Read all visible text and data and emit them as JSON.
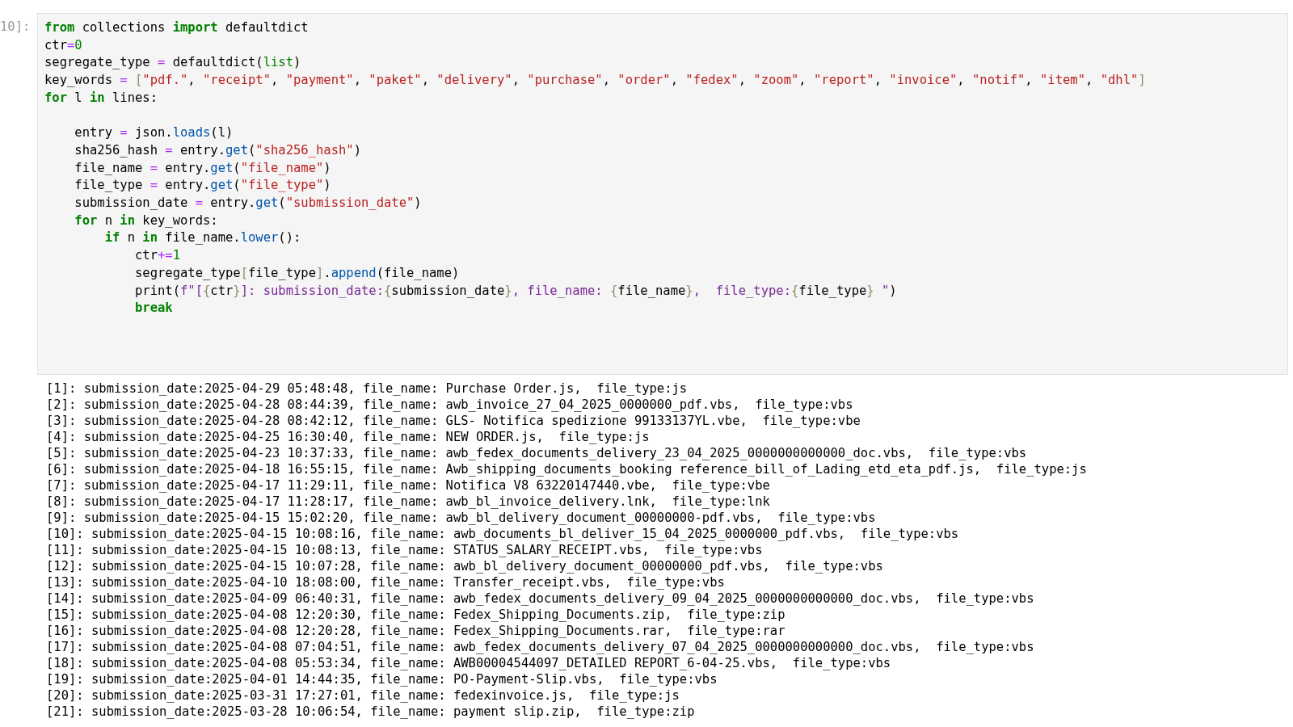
{
  "cell": {
    "prompt": "10]:",
    "code_lines": [
      {
        "space_before": false,
        "tokens": [
          {
            "kw": "from"
          },
          {
            "name": " collections "
          },
          {
            "kw": "import"
          },
          {
            "name": " defaultdict"
          }
        ]
      },
      {
        "space_before": false,
        "tokens": [
          {
            "name": "ctr"
          },
          {
            "op": "="
          },
          {
            "num": "0"
          }
        ]
      },
      {
        "space_before": false,
        "tokens": [
          {
            "name": "segregate_type "
          },
          {
            "op": "="
          },
          {
            "name": " defaultdict("
          },
          {
            "builtin": "list"
          },
          {
            "name": ")"
          }
        ]
      },
      {
        "space_before": false,
        "tokens": [
          {
            "name": "key_words "
          },
          {
            "op": "="
          },
          {
            "punct": " ["
          },
          {
            "str": "\"pdf.\""
          },
          {
            "name": ", "
          },
          {
            "str": "\"receipt\""
          },
          {
            "name": ", "
          },
          {
            "str": "\"payment\""
          },
          {
            "name": ", "
          },
          {
            "str": "\"paket\""
          },
          {
            "name": ", "
          },
          {
            "str": "\"delivery\""
          },
          {
            "name": ", "
          },
          {
            "str": "\"purchase\""
          },
          {
            "name": ", "
          },
          {
            "str": "\"order\""
          },
          {
            "name": ", "
          },
          {
            "str": "\"fedex\""
          },
          {
            "name": ", "
          },
          {
            "str": "\"zoom\""
          },
          {
            "name": ", "
          },
          {
            "str": "\"report\""
          },
          {
            "name": ", "
          },
          {
            "str": "\"invoice\""
          },
          {
            "name": ", "
          },
          {
            "str": "\"notif\""
          },
          {
            "name": ", "
          },
          {
            "str": "\"item\""
          },
          {
            "name": ", "
          },
          {
            "str": "\"dhl\""
          },
          {
            "punct": "]"
          }
        ]
      },
      {
        "space_before": false,
        "tokens": [
          {
            "kw": "for"
          },
          {
            "name": " l "
          },
          {
            "kw": "in"
          },
          {
            "name": " lines:"
          }
        ]
      },
      {
        "space_before": true,
        "tokens": [
          {
            "name": "    entry "
          },
          {
            "op": "="
          },
          {
            "name": " json."
          },
          {
            "method": "loads"
          },
          {
            "name": "(l)"
          }
        ]
      },
      {
        "space_before": false,
        "tokens": [
          {
            "name": "    sha256_hash "
          },
          {
            "op": "="
          },
          {
            "name": " entry."
          },
          {
            "method": "get"
          },
          {
            "name": "("
          },
          {
            "str": "\"sha256_hash\""
          },
          {
            "name": ")"
          }
        ]
      },
      {
        "space_before": false,
        "tokens": [
          {
            "name": "    file_name "
          },
          {
            "op": "="
          },
          {
            "name": " entry."
          },
          {
            "method": "get"
          },
          {
            "name": "("
          },
          {
            "str": "\"file_name\""
          },
          {
            "name": ")"
          }
        ]
      },
      {
        "space_before": false,
        "tokens": [
          {
            "name": "    file_type "
          },
          {
            "op": "="
          },
          {
            "name": " entry."
          },
          {
            "method": "get"
          },
          {
            "name": "("
          },
          {
            "str": "\"file_type\""
          },
          {
            "name": ")"
          }
        ]
      },
      {
        "space_before": false,
        "tokens": [
          {
            "name": "    submission_date "
          },
          {
            "op": "="
          },
          {
            "name": " entry."
          },
          {
            "method": "get"
          },
          {
            "name": "("
          },
          {
            "str": "\"submission_date\""
          },
          {
            "name": ")"
          }
        ]
      },
      {
        "space_before": false,
        "tokens": [
          {
            "kw": "    for"
          },
          {
            "name": " n "
          },
          {
            "kw": "in"
          },
          {
            "name": " key_words:"
          }
        ]
      },
      {
        "space_before": false,
        "tokens": [
          {
            "kw": "        if"
          },
          {
            "name": " n "
          },
          {
            "kw": "in"
          },
          {
            "name": " file_name."
          },
          {
            "method": "lower"
          },
          {
            "name": "():"
          }
        ]
      },
      {
        "space_before": false,
        "tokens": [
          {
            "name": "            ctr"
          },
          {
            "op": "+="
          },
          {
            "num": "1"
          }
        ]
      },
      {
        "space_before": false,
        "tokens": [
          {
            "name": "            segregate_type"
          },
          {
            "punct": "["
          },
          {
            "name": "file_type"
          },
          {
            "punct": "]"
          },
          {
            "name": "."
          },
          {
            "method": "append"
          },
          {
            "name": "(file_name)"
          }
        ]
      },
      {
        "space_before": false,
        "tokens": [
          {
            "name": "            print("
          },
          {
            "fstr": "f\"["
          },
          {
            "brace": "{"
          },
          {
            "name": "ctr"
          },
          {
            "brace": "}"
          },
          {
            "fstr": "]: submission_date:"
          },
          {
            "brace": "{"
          },
          {
            "name": "submission_date"
          },
          {
            "brace": "}"
          },
          {
            "fstr": ", file_name: "
          },
          {
            "brace": "{"
          },
          {
            "name": "file_name"
          },
          {
            "brace": "}"
          },
          {
            "fstr": ",  file_type:"
          },
          {
            "brace": "{"
          },
          {
            "name": "file_type"
          },
          {
            "brace": "}"
          },
          {
            "fstr": " \""
          },
          {
            "name": ")"
          }
        ]
      },
      {
        "space_before": false,
        "tokens": [
          {
            "kw": "            break"
          }
        ]
      }
    ],
    "output_lines": [
      "[1]: submission_date:2025-04-29 05:48:48, file_name: Purchase Order.js,  file_type:js",
      "[2]: submission_date:2025-04-28 08:44:39, file_name: awb_invoice_27_04_2025_0000000_pdf.vbs,  file_type:vbs",
      "[3]: submission_date:2025-04-28 08:42:12, file_name: GLS- Notifica spedizione 99133137YL.vbe,  file_type:vbe",
      "[4]: submission_date:2025-04-25 16:30:40, file_name: NEW ORDER.js,  file_type:js",
      "[5]: submission_date:2025-04-23 10:37:33, file_name: awb_fedex_documents_delivery_23_04_2025_0000000000000_doc.vbs,  file_type:vbs",
      "[6]: submission_date:2025-04-18 16:55:15, file_name: Awb_shipping_documents_booking reference_bill_of_Lading_etd_eta_pdf.js,  file_type:js",
      "[7]: submission_date:2025-04-17 11:29:11, file_name: Notifica V8 63220147440.vbe,  file_type:vbe",
      "[8]: submission_date:2025-04-17 11:28:17, file_name: awb_bl_invoice_delivery.lnk,  file_type:lnk",
      "[9]: submission_date:2025-04-15 15:02:20, file_name: awb_bl_delivery_document_00000000-pdf.vbs,  file_type:vbs",
      "[10]: submission_date:2025-04-15 10:08:16, file_name: awb_documents_bl_deliver_15_04_2025_0000000_pdf.vbs,  file_type:vbs",
      "[11]: submission_date:2025-04-15 10:08:13, file_name: STATUS_SALARY_RECEIPT.vbs,  file_type:vbs",
      "[12]: submission_date:2025-04-15 10:07:28, file_name: awb_bl_delivery_document_00000000_pdf.vbs,  file_type:vbs",
      "[13]: submission_date:2025-04-10 18:08:00, file_name: Transfer_receipt.vbs,  file_type:vbs",
      "[14]: submission_date:2025-04-09 06:40:31, file_name: awb_fedex_documents_delivery_09_04_2025_0000000000000_doc.vbs,  file_type:vbs",
      "[15]: submission_date:2025-04-08 12:20:30, file_name: Fedex_Shipping_Documents.zip,  file_type:zip",
      "[16]: submission_date:2025-04-08 12:20:28, file_name: Fedex_Shipping_Documents.rar,  file_type:rar",
      "[17]: submission_date:2025-04-08 07:04:51, file_name: awb_fedex_documents_delivery_07_04_2025_0000000000000_doc.vbs,  file_type:vbs",
      "[18]: submission_date:2025-04-08 05:53:34, file_name: AWB00004544097_DETAILED REPORT_6-04-25.vbs,  file_type:vbs",
      "[19]: submission_date:2025-04-01 14:44:35, file_name: PO-Payment-Slip.vbs,  file_type:vbs",
      "[20]: submission_date:2025-03-31 17:27:01, file_name: fedexinvoice.js,  file_type:js",
      "[21]: submission_date:2025-03-28 10:06:54, file_name: payment slip.zip,  file_type:zip"
    ]
  }
}
